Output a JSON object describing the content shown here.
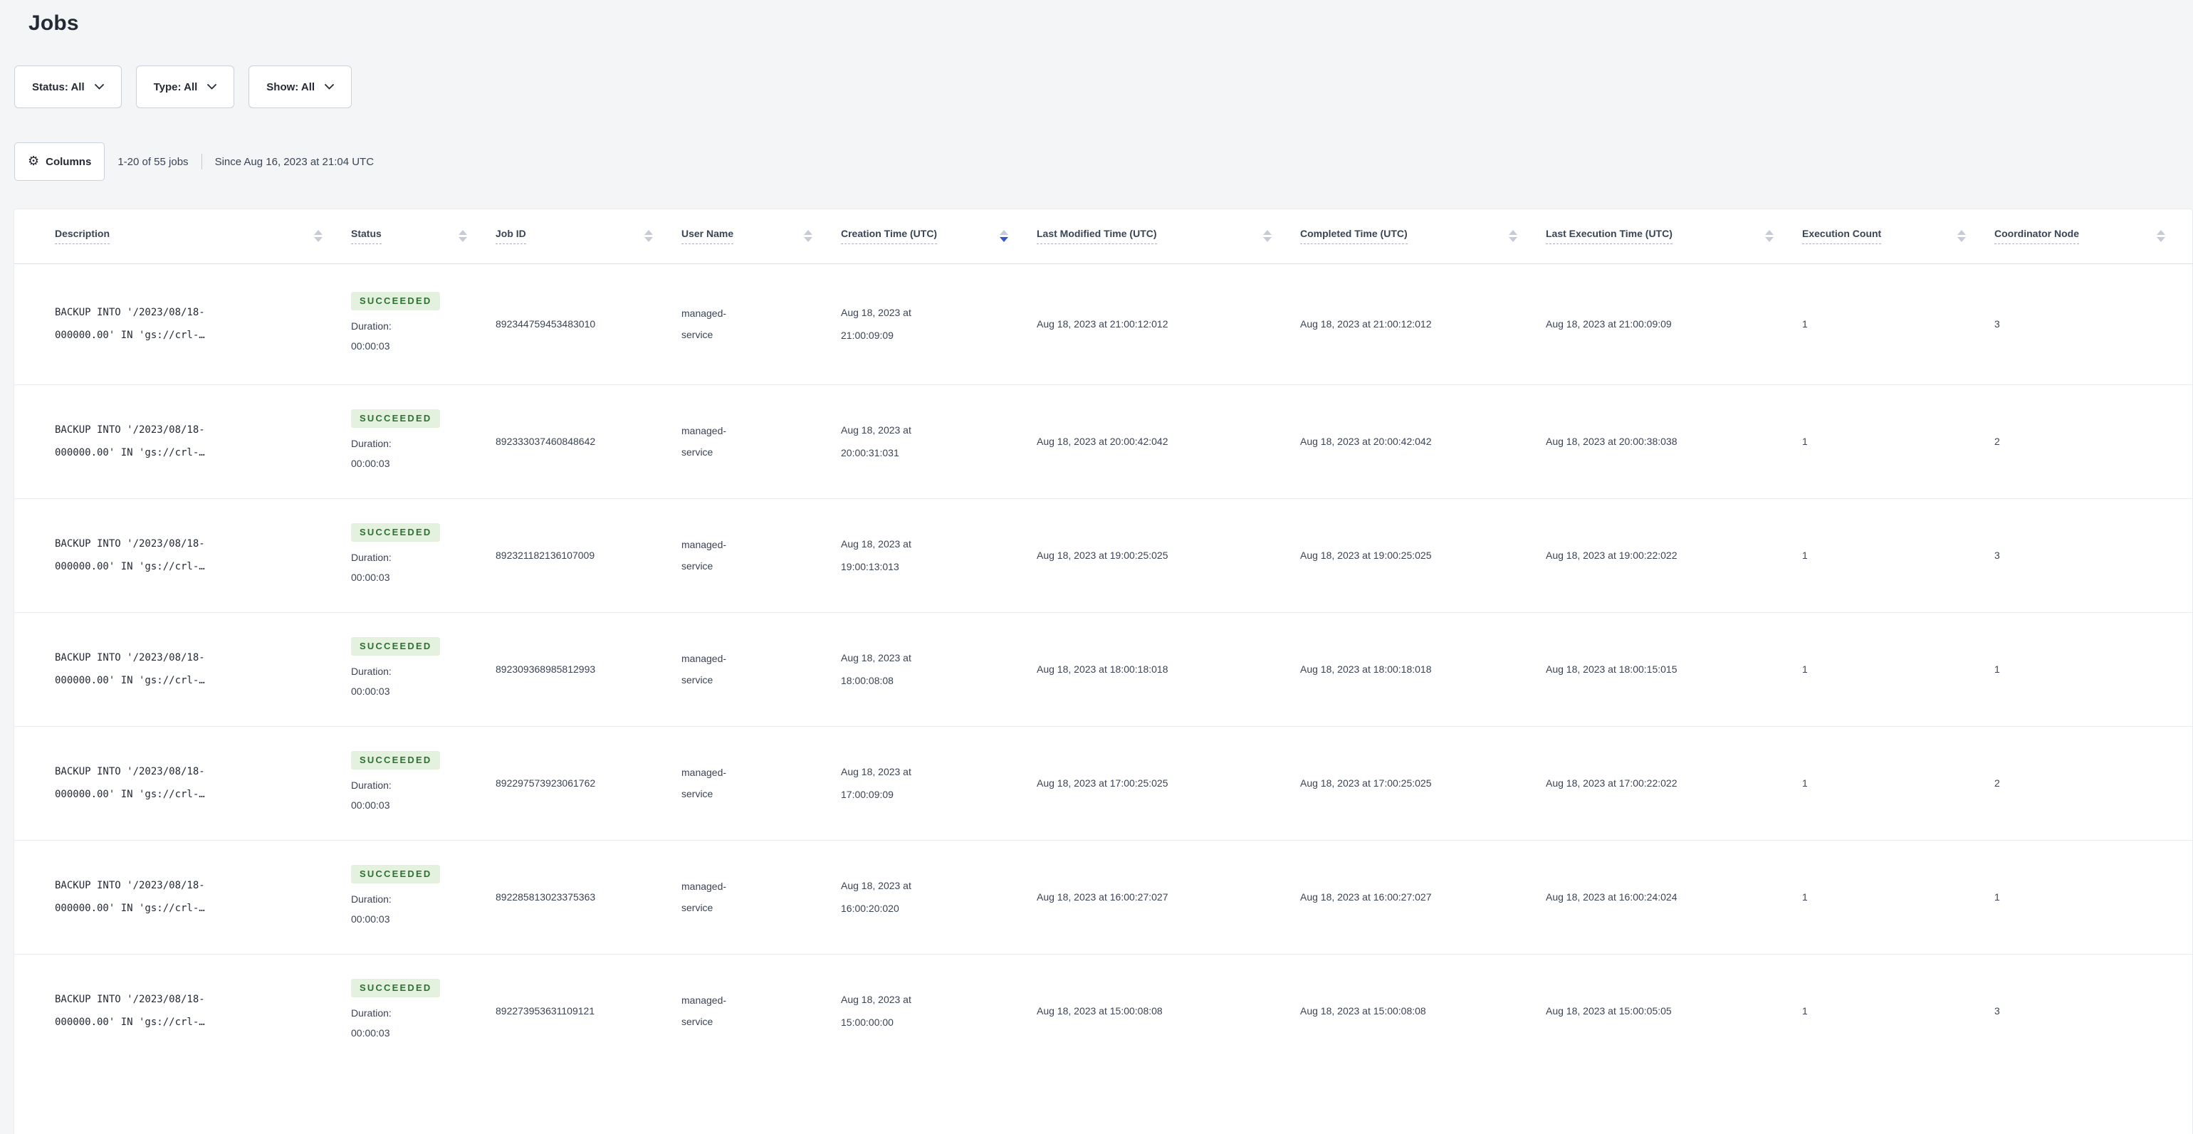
{
  "page": {
    "title": "Jobs"
  },
  "filters": [
    {
      "label": "Status: All"
    },
    {
      "label": "Type: All"
    },
    {
      "label": "Show: All"
    }
  ],
  "toolbar": {
    "columns_label": "Columns",
    "count_text": "1-20 of 55 jobs",
    "since_text": "Since Aug 16, 2023 at 21:04 UTC"
  },
  "icons": {
    "gear": "⚙",
    "filter_chevron": "chevron-down-icon",
    "sort": "sort-arrows-icon"
  },
  "colors": {
    "page_background": "#f4f5f7",
    "card_background": "#ffffff",
    "badge_background": "#e4f1de",
    "badge_text": "#2d7231",
    "active_sort_arrow": "#3556d2",
    "text_primary": "#242a35",
    "text_body": "#394455"
  },
  "table": {
    "duration_label": "Duration:",
    "columns": [
      {
        "label": "Description",
        "sort": "none"
      },
      {
        "label": "Status",
        "sort": "none"
      },
      {
        "label": "Job ID",
        "sort": "none"
      },
      {
        "label": "User Name",
        "sort": "none"
      },
      {
        "label": "Creation Time (UTC)",
        "sort": "desc"
      },
      {
        "label": "Last Modified Time (UTC)",
        "sort": "none"
      },
      {
        "label": "Completed Time (UTC)",
        "sort": "none"
      },
      {
        "label": "Last Execution Time (UTC)",
        "sort": "none"
      },
      {
        "label": "Execution Count",
        "sort": "none"
      },
      {
        "label": "Coordinator Node",
        "sort": "none"
      }
    ],
    "rows": [
      {
        "description": "BACKUP INTO '/2023/08/18-000000.00' IN 'gs://crl-…",
        "status": "SUCCEEDED",
        "duration": "00:00:03",
        "job_id": "892344759453483010",
        "user_name": "managed-service",
        "creation_time": "Aug 18, 2023 at 21:00:09:09",
        "last_modified_time": "Aug 18, 2023 at 21:00:12:012",
        "completed_time": "Aug 18, 2023 at 21:00:12:012",
        "last_execution_time": "Aug 18, 2023 at 21:00:09:09",
        "execution_count": "1",
        "coordinator_node": "3"
      },
      {
        "description": "BACKUP INTO '/2023/08/18-000000.00' IN 'gs://crl-…",
        "status": "SUCCEEDED",
        "duration": "00:00:03",
        "job_id": "892333037460848642",
        "user_name": "managed-service",
        "creation_time": "Aug 18, 2023 at 20:00:31:031",
        "last_modified_time": "Aug 18, 2023 at 20:00:42:042",
        "completed_time": "Aug 18, 2023 at 20:00:42:042",
        "last_execution_time": "Aug 18, 2023 at 20:00:38:038",
        "execution_count": "1",
        "coordinator_node": "2"
      },
      {
        "description": "BACKUP INTO '/2023/08/18-000000.00' IN 'gs://crl-…",
        "status": "SUCCEEDED",
        "duration": "00:00:03",
        "job_id": "892321182136107009",
        "user_name": "managed-service",
        "creation_time": "Aug 18, 2023 at 19:00:13:013",
        "last_modified_time": "Aug 18, 2023 at 19:00:25:025",
        "completed_time": "Aug 18, 2023 at 19:00:25:025",
        "last_execution_time": "Aug 18, 2023 at 19:00:22:022",
        "execution_count": "1",
        "coordinator_node": "3"
      },
      {
        "description": "BACKUP INTO '/2023/08/18-000000.00' IN 'gs://crl-…",
        "status": "SUCCEEDED",
        "duration": "00:00:03",
        "job_id": "892309368985812993",
        "user_name": "managed-service",
        "creation_time": "Aug 18, 2023 at 18:00:08:08",
        "last_modified_time": "Aug 18, 2023 at 18:00:18:018",
        "completed_time": "Aug 18, 2023 at 18:00:18:018",
        "last_execution_time": "Aug 18, 2023 at 18:00:15:015",
        "execution_count": "1",
        "coordinator_node": "1"
      },
      {
        "description": "BACKUP INTO '/2023/08/18-000000.00' IN 'gs://crl-…",
        "status": "SUCCEEDED",
        "duration": "00:00:03",
        "job_id": "892297573923061762",
        "user_name": "managed-service",
        "creation_time": "Aug 18, 2023 at 17:00:09:09",
        "last_modified_time": "Aug 18, 2023 at 17:00:25:025",
        "completed_time": "Aug 18, 2023 at 17:00:25:025",
        "last_execution_time": "Aug 18, 2023 at 17:00:22:022",
        "execution_count": "1",
        "coordinator_node": "2"
      },
      {
        "description": "BACKUP INTO '/2023/08/18-000000.00' IN 'gs://crl-…",
        "status": "SUCCEEDED",
        "duration": "00:00:03",
        "job_id": "892285813023375363",
        "user_name": "managed-service",
        "creation_time": "Aug 18, 2023 at 16:00:20:020",
        "last_modified_time": "Aug 18, 2023 at 16:00:27:027",
        "completed_time": "Aug 18, 2023 at 16:00:27:027",
        "last_execution_time": "Aug 18, 2023 at 16:00:24:024",
        "execution_count": "1",
        "coordinator_node": "1"
      },
      {
        "description": "BACKUP INTO '/2023/08/18-000000.00' IN 'gs://crl-…",
        "status": "SUCCEEDED",
        "duration": "00:00:03",
        "job_id": "892273953631109121",
        "user_name": "managed-service",
        "creation_time": "Aug 18, 2023 at 15:00:00:00",
        "last_modified_time": "Aug 18, 2023 at 15:00:08:08",
        "completed_time": "Aug 18, 2023 at 15:00:08:08",
        "last_execution_time": "Aug 18, 2023 at 15:00:05:05",
        "execution_count": "1",
        "coordinator_node": "3"
      }
    ]
  }
}
